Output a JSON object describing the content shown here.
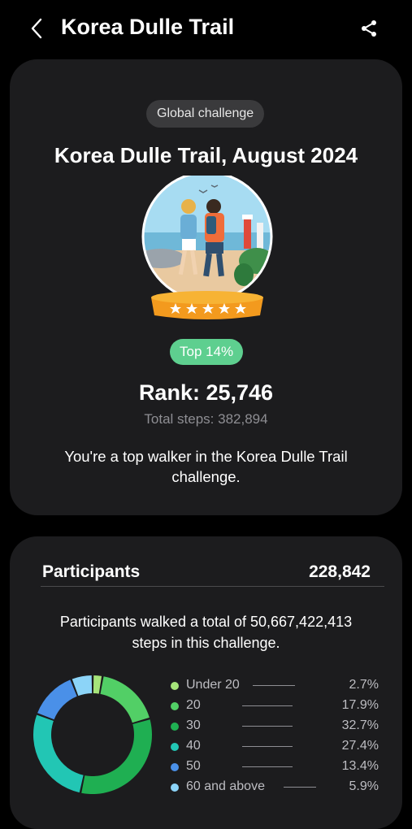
{
  "header": {
    "title": "Korea Dulle Trail",
    "back_icon": "chevron-left-icon",
    "share_icon": "share-icon"
  },
  "challenge": {
    "type_badge": "Global challenge",
    "title": "Korea Dulle Trail, August 2024",
    "top_badge": "Top 14%",
    "rank": "Rank: 25,746",
    "total_steps": "Total steps: 382,894",
    "message": "You're a top walker in the Korea Dulle Trail challenge."
  },
  "participants": {
    "label": "Participants",
    "count": "228,842",
    "summary": "Participants walked a total of 50,667,422,413 steps in this challenge."
  },
  "chart_data": {
    "type": "pie",
    "categories": [
      "Under 20",
      "20",
      "30",
      "40",
      "50",
      "60 and above"
    ],
    "values": [
      2.7,
      17.9,
      32.7,
      27.4,
      13.4,
      5.9
    ],
    "labels": [
      "2.7%",
      "17.9%",
      "32.7%",
      "27.4%",
      "13.4%",
      "5.9%"
    ],
    "colors": [
      "#a6e47a",
      "#52cf66",
      "#1faf52",
      "#22c6b4",
      "#4a90e8",
      "#8cd4f8"
    ],
    "donut": true,
    "legend": "right"
  },
  "colors": {
    "background": "#000000",
    "card": "#1c1c1e",
    "top_badge": "#5ecf8f",
    "muted_text": "#8e8e93"
  }
}
